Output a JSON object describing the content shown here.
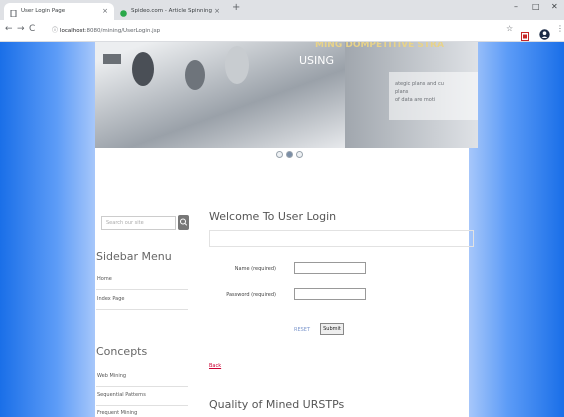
{
  "browser": {
    "tabs": [
      {
        "title": "User Login Page",
        "active": true
      },
      {
        "title": "Spideo.com - Article Spinning",
        "active": false
      }
    ],
    "tab_close": "×",
    "new_tab": "+",
    "window_controls": {
      "minimize": "–",
      "maximize": "□",
      "close": "✕"
    },
    "nav": {
      "back": "←",
      "forward": "→",
      "reload": "C"
    },
    "url_host": "localhost",
    "url_path": ":8080/mining/UserLogin.jsp",
    "star": "☆",
    "menu": "⋮"
  },
  "banner": {
    "heading_top": "MING DOMPETITIVE STRA",
    "heading_sub": "USING",
    "text_lines": [
      "ategic plans and cu",
      "plans",
      "of data are moti"
    ]
  },
  "search": {
    "placeholder": "Search our site"
  },
  "sidebar": {
    "menu_title": "Sidebar Menu",
    "menu_items": [
      "Home",
      "Index Page"
    ],
    "concepts_title": "Concepts",
    "concepts_items": [
      "Web Mining",
      "Sequential Patterns",
      "Frequent Mining"
    ]
  },
  "main": {
    "title": "Welcome To User Login",
    "name_label": "Name (required)",
    "password_label": "Password (required)",
    "reset_label": "RESET",
    "submit_label": "Submit",
    "back_link": "Back",
    "section_title": "Quality of Mined URSTPs"
  },
  "colors": {
    "side_blue": "#1a6fe8",
    "link_red": "#cc0033"
  }
}
